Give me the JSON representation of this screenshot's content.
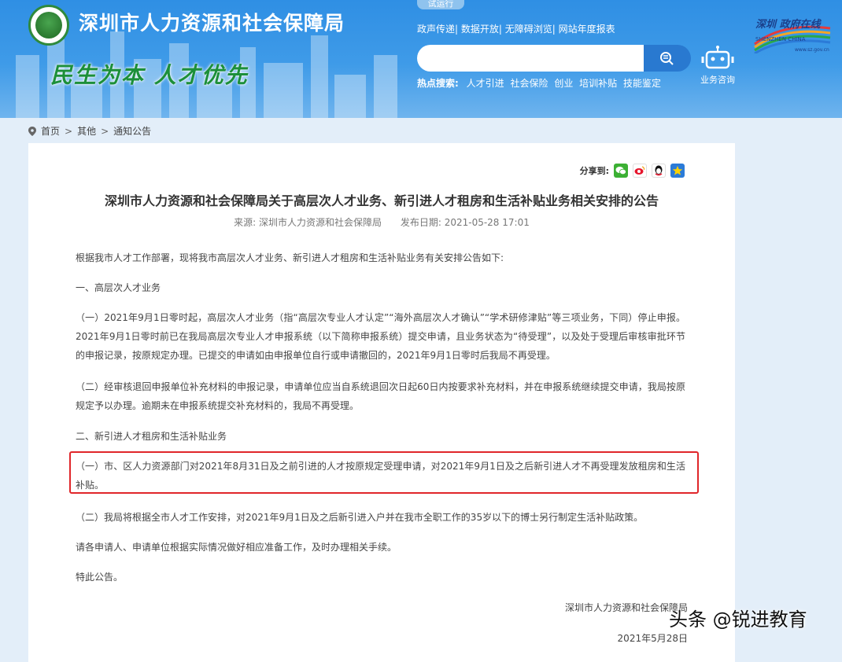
{
  "header": {
    "org_name": "深圳市人力资源和社会保障局",
    "slogan": "民生为本 人才优先",
    "trial_badge": "试运行",
    "top_links": [
      "政声传递|",
      "数据开放|",
      "无障碍浏览|",
      "网站年度报表"
    ],
    "search": {
      "placeholder": ""
    },
    "hot_label": "热点搜索:",
    "hot_keywords": [
      "人才引进",
      "社会保险",
      "创业",
      "培训补贴",
      "技能鉴定"
    ],
    "consult_label": "业务咨询",
    "shenzhen_logo": {
      "line1": "深圳 政府在线",
      "line2": "SHENZHEN CHINA",
      "line3": "www.sz.gov.cn"
    }
  },
  "breadcrumb": {
    "home": "首页",
    "sep": ">",
    "level2": "其他",
    "level3": "通知公告"
  },
  "share": {
    "label": "分享到:",
    "icons": [
      "wechat-icon",
      "weibo-icon",
      "qq-icon",
      "qzone-icon"
    ]
  },
  "article": {
    "title": "深圳市人力资源和社会保障局关于高层次人才业务、新引进人才租房和生活补贴业务相关安排的公告",
    "source": "来源: 深圳市人力资源和社会保障局",
    "date": "发布日期: 2021-05-28 17:01",
    "paragraphs": [
      "根据我市人才工作部署，现将我市高层次人才业务、新引进人才租房和生活补贴业务有关安排公告如下:",
      "一、高层次人才业务",
      "（一）2021年9月1日零时起，高层次人才业务（指“高层次专业人才认定”“海外高层次人才确认”“学术研修津贴”等三项业务，下同）停止申报。2021年9月1日零时前已在我局高层次专业人才申报系统（以下简称申报系统）提交申请，且业务状态为“待受理”，以及处于受理后审核审批环节的申报记录，按原规定办理。已提交的申请如由申报单位自行或申请撤回的，2021年9月1日零时后我局不再受理。",
      "（二）经审核退回申报单位补充材料的申报记录，申请单位应当自系统退回次日起60日内按要求补充材料，并在申报系统继续提交申请，我局按原规定予以办理。逾期未在申报系统提交补充材料的，我局不再受理。",
      "二、新引进人才租房和生活补贴业务",
      "（一）市、区人力资源部门对2021年8月31日及之前引进的人才按原规定受理申请，对2021年9月1日及之后新引进人才不再受理发放租房和生活补贴。",
      "（二）我局将根据全市人才工作安排，对2021年9月1日及之后新引进入户并在我市全职工作的35岁以下的博士另行制定生活补贴政策。",
      "请各申请人、申请单位根据实际情况做好相应准备工作，及时办理相关手续。",
      "特此公告。"
    ],
    "sign_org": "深圳市人力资源和社会保障局",
    "sign_date": "2021年5月28日"
  },
  "watermark": "头条 @锐进教育"
}
